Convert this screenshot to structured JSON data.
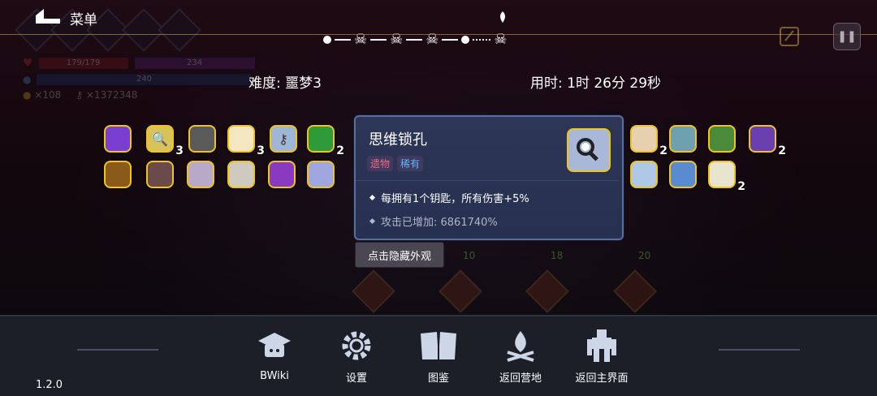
{
  "menu": {
    "label": "菜单"
  },
  "stats": {
    "hp": "179/179",
    "shield": "234",
    "mana": "240",
    "gold": "×108",
    "keys": "×1372348"
  },
  "route": {
    "stages": [
      "dot",
      "skull",
      "skull",
      "skull",
      "dot",
      "boss"
    ]
  },
  "run": {
    "difficulty": "难度: 噩梦3",
    "time": "用时: 1时 26分 29秒"
  },
  "relics": [
    {
      "icon": "rainbow-cape-icon",
      "color": "#7a3fd0",
      "count": ""
    },
    {
      "icon": "magnifier-icon",
      "color": "#d8c25a",
      "count": "3"
    },
    {
      "icon": "stone-idol-icon",
      "color": "#5a5a5a",
      "count": ""
    },
    {
      "icon": "cone-shell-icon",
      "color": "#f4e6c0",
      "count": "3"
    },
    {
      "icon": "key-icon",
      "color": "#9fb6d4",
      "count": ""
    },
    {
      "icon": "green-crystal-icon",
      "color": "#2f9a3a",
      "count": "2"
    },
    {
      "icon": "feather-icon",
      "color": "#e6d0b0",
      "count": "2"
    },
    {
      "icon": "compass-icon",
      "color": "#6fa0b0",
      "count": ""
    },
    {
      "icon": "hat-icon",
      "color": "#4a8a3a",
      "count": ""
    },
    {
      "icon": "wizard-hat-icon",
      "color": "#6a3fb0",
      "count": "2"
    },
    {
      "icon": "treasure-chest-icon",
      "color": "#8a5a1a",
      "count": ""
    },
    {
      "icon": "cloak-icon",
      "color": "#6a4a4a",
      "count": ""
    },
    {
      "icon": "rope-icon",
      "color": "#b9a9c9",
      "count": ""
    },
    {
      "icon": "ribcage-icon",
      "color": "#cfc9c0",
      "count": ""
    },
    {
      "icon": "purple-boot-icon",
      "color": "#8a3ac0",
      "count": ""
    },
    {
      "icon": "crystal-drop-icon",
      "color": "#9fa6e0",
      "count": ""
    },
    {
      "icon": "ice-crystal-icon",
      "color": "#b0c8e8",
      "count": ""
    },
    {
      "icon": "mirror-icon",
      "color": "#5a8ad0",
      "count": ""
    },
    {
      "icon": "teeth-icon",
      "color": "#e8e4d0",
      "count": "2"
    }
  ],
  "tooltip": {
    "title": "思维锁孔",
    "type": "遗物",
    "rarity": "稀有",
    "effect": "每拥有1个钥匙，所有伤害+5%",
    "bonus": "攻击已增加: 6861740%"
  },
  "hide_button": "点击隐藏外观",
  "shop": {
    "prices": [
      "10",
      "18",
      "20"
    ]
  },
  "nav": {
    "bwiki": "BWiki",
    "settings": "设置",
    "codex": "图鉴",
    "camp": "返回营地",
    "main": "返回主界面"
  },
  "version": "1.2.0"
}
